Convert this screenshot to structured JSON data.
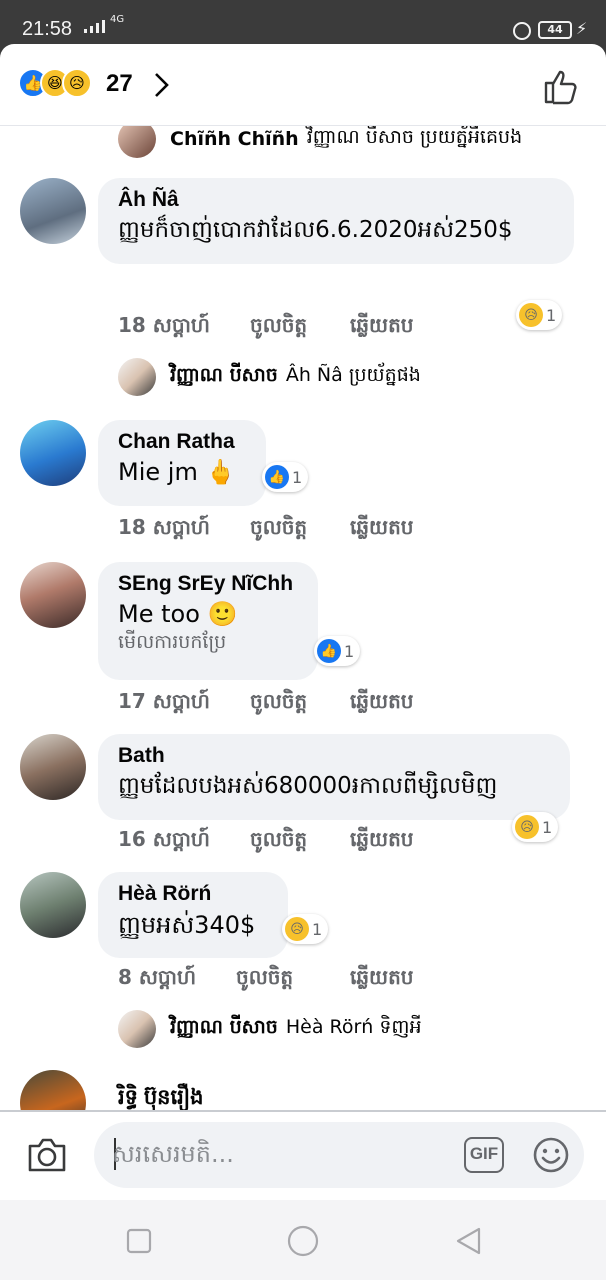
{
  "status_bar": {
    "time": "21:58",
    "network": "4G",
    "battery": "44"
  },
  "header": {
    "reaction_icons": [
      "like-icon",
      "haha-icon",
      "sad-icon"
    ],
    "reaction_count": "27"
  },
  "comments": [
    {
      "reply": {
        "name": "Chĩñh Chĩñh",
        "text": "វិញ្ញាណ បីសាច ប្រយត្ន័អីគេបង"
      }
    },
    {
      "name": "Âh Ñâ",
      "text": "ញ្ញមក៏ចាញ់បោកវាដែល6.6.2020អស់250$",
      "time": "18 សប្តាហ៍",
      "like": "ចូលចិត្ត",
      "reply_label": "ឆ្លើយតប",
      "reaction": {
        "icon": "sad-icon",
        "count": "1"
      }
    },
    {
      "reply": {
        "name": "វិញ្ញាណ បីសាច",
        "text": "Âh Ñâ ប្រយ័ត្នផង"
      }
    },
    {
      "name": "Chan Ratha",
      "text": "Mie jm 🖕",
      "time": "18 សប្តាហ៍",
      "like": "ចូលចិត្ត",
      "reply_label": "ឆ្លើយតប",
      "reaction": {
        "icon": "like-icon",
        "count": "1"
      }
    },
    {
      "name": "SEng SrEy NĩChh",
      "text": "Me too 🙂",
      "see_translation": "មើលការបកប្រែ",
      "time": "17 សប្តាហ៍",
      "like": "ចូលចិត្ត",
      "reply_label": "ឆ្លើយតប",
      "reaction": {
        "icon": "like-icon",
        "count": "1"
      }
    },
    {
      "name": "Bath",
      "text": "ញ្ញមដែលបងអស់680000៛កាលពីម្សិលមិញ",
      "time": "16 សប្តាហ៍",
      "like": "ចូលចិត្ត",
      "reply_label": "ឆ្លើយតប",
      "reaction": {
        "icon": "sad-icon",
        "count": "1"
      }
    },
    {
      "name": "Hèà Rörń",
      "text": "ញ្ញមអស់340$",
      "time": "8 សប្តាហ៍",
      "like": "ចូលចិត្ត",
      "reply_label": "ឆ្លើយតប",
      "reaction": {
        "icon": "sad-icon",
        "count": "1"
      }
    },
    {
      "reply": {
        "name": "វិញ្ញាណ បីសាច",
        "text": "Hèà Rörń ទិញអី"
      }
    },
    {
      "name": "រិទ្ធិ ប៊ុនរឿង"
    }
  ],
  "composer": {
    "placeholder": "សរសេរមតិ...",
    "gif_label": "GIF"
  },
  "colors": {
    "accent": "#1877f2",
    "bubble": "#f0f2f5",
    "meta": "#65676b",
    "reaction_yellow": "#f7c12b"
  }
}
